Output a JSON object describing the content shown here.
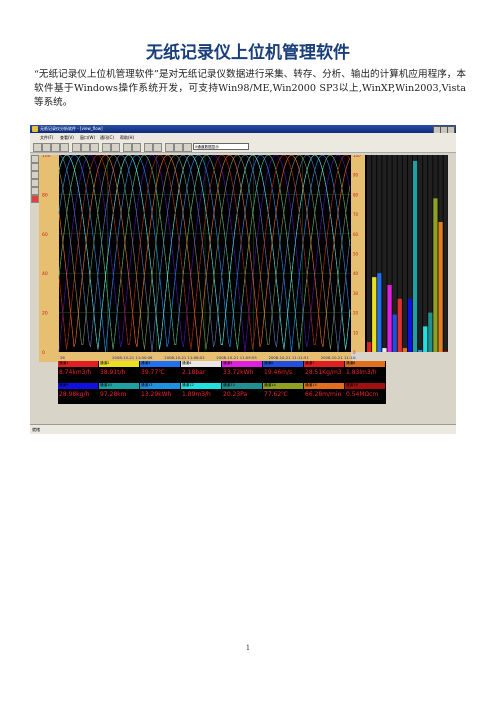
{
  "document": {
    "title": "无纸记录仪上位机管理软件",
    "intro": "“无纸记录仪上位机管理软件”是对无纸记录仪数据进行采集、转存、分析、输出的计算机应用程序，本软件基于Windows操作系统开发，可支持Win98/ME,Win2000 SP3以上,WinXP,Win2003,Vista等系统。",
    "page_number": "1"
  },
  "app": {
    "window_title": "无纸记录仪分析软件 - [view_flow]",
    "menu": [
      "文件(F)",
      "查看(V)",
      "窗口(W)",
      "通讯(C)",
      "帮助(H)"
    ],
    "toolbar_select": "0通道数据显示",
    "status_text": "就绪",
    "colors": {
      "plot_bg": "#000000",
      "axis_bg": "#e6c070",
      "legend_bg": "#000000",
      "value_text": "#ee2233"
    },
    "y_ticks": [
      "100",
      "80",
      "60",
      "40",
      "20",
      "0"
    ],
    "bar_ticks": [
      "100",
      "90",
      "80",
      "70",
      "60",
      "50",
      "40",
      "30",
      "20",
      "10",
      "0"
    ],
    "x_ticks": [
      "26",
      "2008-10-21 11:00:06",
      "2008-10-21 11:08:02",
      "2008-10-21 11:09:55",
      "2008-10-21 11:11:51",
      "2008-10-21 11:14:"
    ],
    "legend": [
      {
        "name": "通道1",
        "value": "8.74km3/h",
        "color": "#e02020"
      },
      {
        "name": "通道2",
        "value": "38.91t/h",
        "color": "#e8e020"
      },
      {
        "name": "通道3",
        "value": "39.77℃",
        "color": "#2070f0"
      },
      {
        "name": "通道4",
        "value": "2.18bar",
        "color": "#e8e8e8"
      },
      {
        "name": "通道5",
        "value": "33.72kWh",
        "color": "#e020e0"
      },
      {
        "name": "通道6",
        "value": "19.46m/s",
        "color": "#2050e0"
      },
      {
        "name": "通道7",
        "value": "28.51Kg/m3",
        "color": "#e02020"
      },
      {
        "name": "通道8",
        "value": "1.83lm3/h",
        "color": "#e07020"
      },
      {
        "name": "通道9",
        "value": "28.98kg/h",
        "color": "#1010e0"
      },
      {
        "name": "通道10",
        "value": "97.28km",
        "color": "#20a0a0"
      },
      {
        "name": "通道11",
        "value": "13.29kWh",
        "color": "#2090e0"
      },
      {
        "name": "通道12",
        "value": "1.89m3/h",
        "color": "#20e0e0"
      },
      {
        "name": "通道13",
        "value": "20.23Pa",
        "color": "#209090"
      },
      {
        "name": "通道14",
        "value": "77.62℃",
        "color": "#90a020"
      },
      {
        "name": "通道15",
        "value": "66.28m/min",
        "color": "#e07020"
      },
      {
        "name": "通道16",
        "value": "0.54MΩcm",
        "color": "#a01010"
      }
    ]
  },
  "chart_data": {
    "type": "line",
    "ylim": [
      0,
      100
    ],
    "series_colors": [
      "#e02020",
      "#e8e020",
      "#2070f0",
      "#e8e8e8",
      "#e020e0",
      "#2050e0",
      "#e03030",
      "#e07020",
      "#1010e0",
      "#20a0a0",
      "#2090e0",
      "#20e0e0",
      "#209090",
      "#90a020",
      "#e08020",
      "#a01010"
    ],
    "bars": [
      5,
      38,
      40,
      2,
      34,
      19,
      27,
      2,
      27,
      97,
      1,
      13,
      20,
      78,
      66,
      0.5
    ],
    "wave_period": 62,
    "wave_amplitude": 100
  }
}
